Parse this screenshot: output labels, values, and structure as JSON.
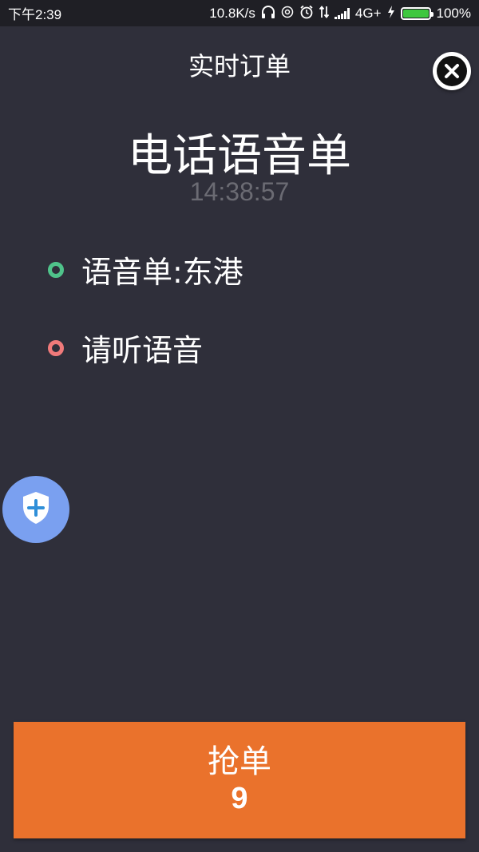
{
  "status_bar": {
    "time": "下午2:39",
    "net_speed": "10.8K/s",
    "network": "4G+",
    "battery": "100%"
  },
  "header": {
    "title": "实时订单"
  },
  "order": {
    "type": "电话语音单",
    "time": "14:38:57",
    "details": [
      {
        "text": "语音单:东港",
        "dot_color": "#4fc38a"
      },
      {
        "text": "请听语音",
        "dot_color": "#f07a7a"
      }
    ]
  },
  "grab_button": {
    "label": "抢单",
    "count": "9"
  },
  "colors": {
    "background": "#2f2f3a",
    "accent": "#ea722c",
    "shield": "#7aa0f0",
    "battery": "#3ec73e"
  }
}
